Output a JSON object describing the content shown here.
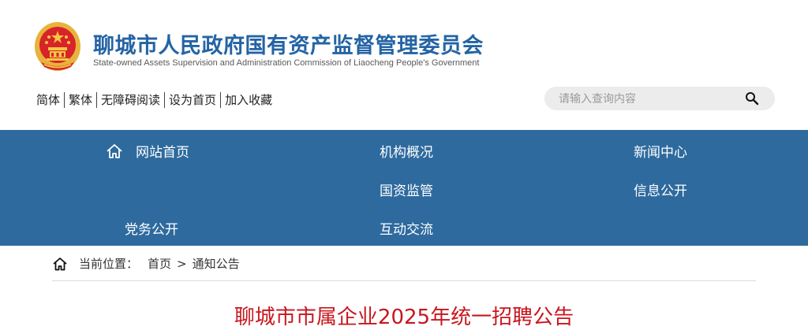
{
  "header": {
    "title": "聊城市人民政府国有资产监督管理委员会",
    "subtitle": "State-owned Assets Supervision and Administration Commission of Liaocheng People's Government",
    "emblem_icon": "national-emblem-icon"
  },
  "util_links": [
    "简体",
    "繁体",
    "无障碍阅读",
    "设为首页",
    "加入收藏"
  ],
  "search": {
    "placeholder": "请输入查询内容",
    "icon": "search-icon"
  },
  "nav": {
    "items": [
      "网站首页",
      "机构概况",
      "新闻中心",
      "国资监管",
      "信息公开",
      "党务公开",
      "互动交流"
    ],
    "home_icon": "home-icon"
  },
  "breadcrumb": {
    "label": "当前位置：",
    "home": "首页",
    "separator": ">",
    "current": "通知公告"
  },
  "article": {
    "title": "聊城市市属企业2025年统一招聘公告"
  },
  "colors": {
    "brand_blue": "#2464a4",
    "nav_bg": "#2e6a9e",
    "title_red": "#c8161d"
  }
}
